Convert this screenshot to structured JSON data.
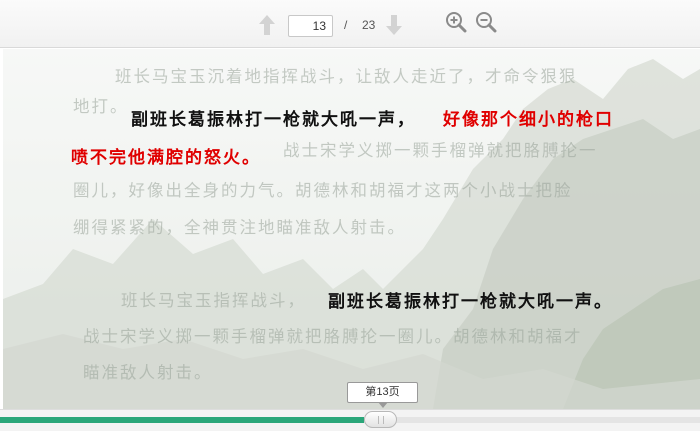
{
  "toolbar": {
    "current_page": "13",
    "separator": "/",
    "total_pages": "23",
    "icons": {
      "prev": "arrow-up-icon",
      "next": "arrow-down-icon",
      "zoom_in": "zoom-in-icon",
      "zoom_out": "zoom-out-icon"
    }
  },
  "slide": {
    "faded_lines": [
      "班长马宝玉沉着地指挥战斗，让敌人走近了，才命令狠狠",
      "地打。",
      "战士宋学义掷一颗手榴弹就把胳膊抡一",
      "圈儿，好像出全身的力气。胡德林和胡福才这两个小战士把脸",
      "绷得紧紧的，全神贯注地瞄准敌人射击。",
      "班长马宝玉指挥战斗，",
      "战士宋学义掷一颗手榴弹就把胳膊抡一圈儿。胡德林和胡福才",
      "瞄准敌人射击。"
    ],
    "highlight1_black": "副班长葛振林打一枪就大吼一声，",
    "highlight1_red_a": "好像那个细小的枪口",
    "highlight1_red_b": "喷不完他满腔的怒火。",
    "highlight2_black": "副班长葛振林打一枪就大吼一声。",
    "colors": {
      "emphasis_red": "#e00000",
      "text_black": "#111111"
    }
  },
  "progress": {
    "page_label": "第13页",
    "fraction": 0.5652,
    "fill_color": "#2aa679"
  }
}
